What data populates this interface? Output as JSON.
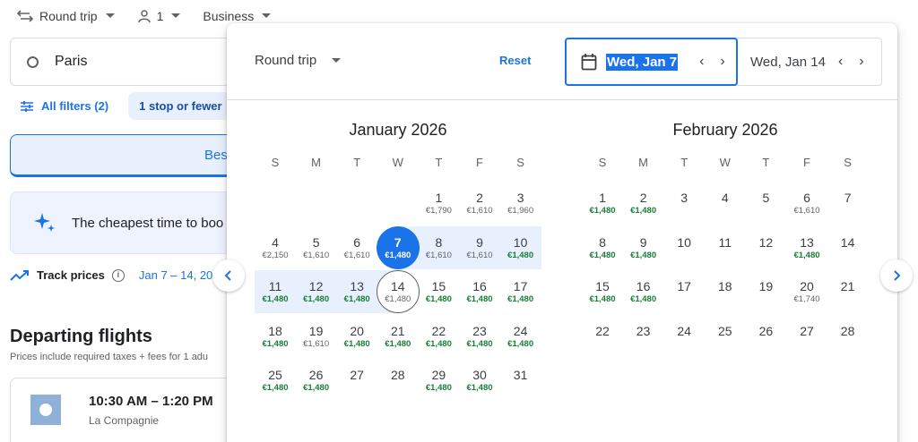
{
  "topbar": {
    "trip_type": "Round trip",
    "passengers": "1",
    "cabin": "Business"
  },
  "search": {
    "origin": "Paris"
  },
  "filters": {
    "all_filters": "All filters (2)",
    "stops_chip": "1 stop or fewer"
  },
  "sort": {
    "best_tab": "Bes"
  },
  "insight": {
    "text": "The cheapest time to boo"
  },
  "track": {
    "label": "Track prices",
    "dates": "Jan 7 – 14, 20"
  },
  "results": {
    "title": "Departing flights",
    "subtitle": "Prices include required taxes + fees for 1 adu",
    "flight": {
      "time": "10:30 AM – 1:20 PM",
      "airline": "La Compagnie"
    }
  },
  "picker": {
    "trip_type": "Round trip",
    "reset": "Reset",
    "departure": "Wed, Jan 7",
    "return": "Wed, Jan 14",
    "weekdays": [
      "S",
      "M",
      "T",
      "W",
      "T",
      "F",
      "S"
    ],
    "months": [
      {
        "title": "January 2026",
        "first_weekday": 4,
        "days": [
          {
            "d": "1",
            "p": "€1,790",
            "low": false
          },
          {
            "d": "2",
            "p": "€1,610",
            "low": false
          },
          {
            "d": "3",
            "p": "€1,960",
            "low": false
          },
          {
            "d": "4",
            "p": "€2,150",
            "low": false
          },
          {
            "d": "5",
            "p": "€1,610",
            "low": false
          },
          {
            "d": "6",
            "p": "€1,610",
            "low": false
          },
          {
            "d": "7",
            "p": "€1,480",
            "low": true
          },
          {
            "d": "8",
            "p": "€1,610",
            "low": false
          },
          {
            "d": "9",
            "p": "€1,610",
            "low": false
          },
          {
            "d": "10",
            "p": "€1,480",
            "low": true
          },
          {
            "d": "11",
            "p": "€1,480",
            "low": true
          },
          {
            "d": "12",
            "p": "€1,480",
            "low": true
          },
          {
            "d": "13",
            "p": "€1,480",
            "low": true
          },
          {
            "d": "14",
            "p": "€1,480",
            "low": false
          },
          {
            "d": "15",
            "p": "€1,480",
            "low": true
          },
          {
            "d": "16",
            "p": "€1,480",
            "low": true
          },
          {
            "d": "17",
            "p": "€1,480",
            "low": true
          },
          {
            "d": "18",
            "p": "€1,480",
            "low": true
          },
          {
            "d": "19",
            "p": "€1,610",
            "low": false
          },
          {
            "d": "20",
            "p": "€1,480",
            "low": true
          },
          {
            "d": "21",
            "p": "€1,480",
            "low": true
          },
          {
            "d": "22",
            "p": "€1,480",
            "low": true
          },
          {
            "d": "23",
            "p": "€1,480",
            "low": true
          },
          {
            "d": "24",
            "p": "€1,480",
            "low": true
          },
          {
            "d": "25",
            "p": "€1,480",
            "low": true
          },
          {
            "d": "26",
            "p": "€1,480",
            "low": true
          },
          {
            "d": "27",
            "p": "",
            "low": false
          },
          {
            "d": "28",
            "p": "",
            "low": false
          },
          {
            "d": "29",
            "p": "€1,480",
            "low": true
          },
          {
            "d": "30",
            "p": "€1,480",
            "low": true
          },
          {
            "d": "31",
            "p": "",
            "low": false
          }
        ]
      },
      {
        "title": "February 2026",
        "first_weekday": 0,
        "days": [
          {
            "d": "1",
            "p": "€1,480",
            "low": true
          },
          {
            "d": "2",
            "p": "€1,480",
            "low": true
          },
          {
            "d": "3",
            "p": "",
            "low": false
          },
          {
            "d": "4",
            "p": "",
            "low": false
          },
          {
            "d": "5",
            "p": "",
            "low": false
          },
          {
            "d": "6",
            "p": "€1,610",
            "low": false
          },
          {
            "d": "7",
            "p": "",
            "low": false
          },
          {
            "d": "8",
            "p": "€1,480",
            "low": true
          },
          {
            "d": "9",
            "p": "€1,480",
            "low": true
          },
          {
            "d": "10",
            "p": "",
            "low": false
          },
          {
            "d": "11",
            "p": "",
            "low": false
          },
          {
            "d": "12",
            "p": "",
            "low": false
          },
          {
            "d": "13",
            "p": "€1,480",
            "low": true
          },
          {
            "d": "14",
            "p": "",
            "low": false
          },
          {
            "d": "15",
            "p": "€1,480",
            "low": true
          },
          {
            "d": "16",
            "p": "€1,480",
            "low": true
          },
          {
            "d": "17",
            "p": "",
            "low": false
          },
          {
            "d": "18",
            "p": "",
            "low": false
          },
          {
            "d": "19",
            "p": "",
            "low": false
          },
          {
            "d": "20",
            "p": "€1,740",
            "low": false
          },
          {
            "d": "21",
            "p": "",
            "low": false
          },
          {
            "d": "22",
            "p": "",
            "low": false
          },
          {
            "d": "23",
            "p": "",
            "low": false
          },
          {
            "d": "24",
            "p": "",
            "low": false
          },
          {
            "d": "25",
            "p": "",
            "low": false
          },
          {
            "d": "26",
            "p": "",
            "low": false
          },
          {
            "d": "27",
            "p": "",
            "low": false
          },
          {
            "d": "28",
            "p": "",
            "low": false
          }
        ]
      }
    ],
    "selection": {
      "start_month": 0,
      "start_day": "7",
      "end_month": 0,
      "end_day": "14"
    }
  }
}
